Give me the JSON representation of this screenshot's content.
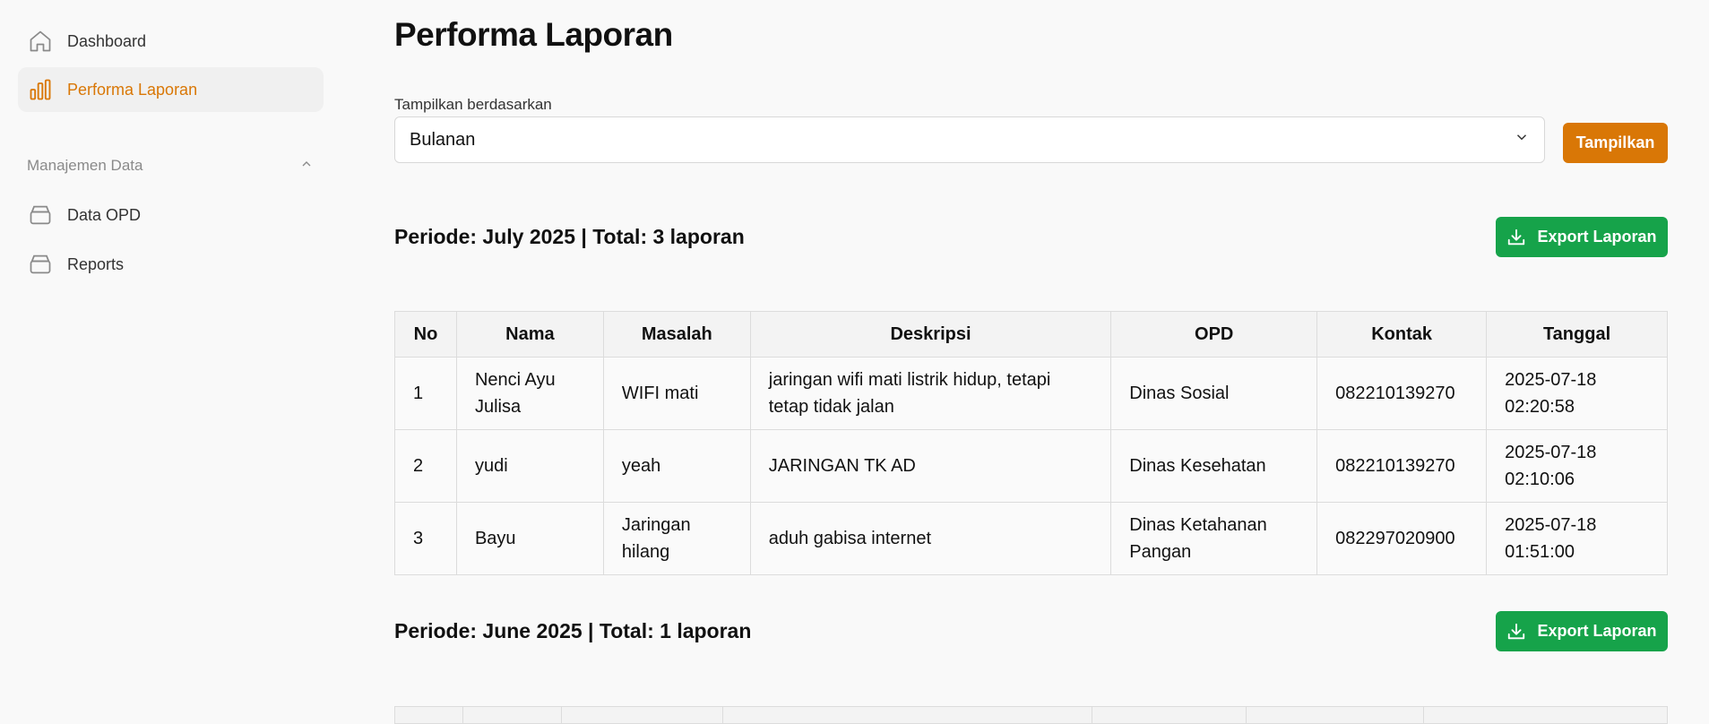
{
  "sidebar": {
    "items": [
      {
        "label": "Dashboard",
        "icon": "home-icon"
      },
      {
        "label": "Performa Laporan",
        "icon": "bar-chart-icon"
      }
    ],
    "section": {
      "label": "Manajemen Data",
      "icon": "chevron-up-icon"
    },
    "section_items": [
      {
        "label": "Data OPD",
        "icon": "database-icon"
      },
      {
        "label": "Reports",
        "icon": "database-icon"
      }
    ]
  },
  "page": {
    "title": "Performa Laporan",
    "filter_label": "Tampilkan berdasarkan",
    "filter_value": "Bulanan",
    "show_button": "Tampilkan"
  },
  "colors": {
    "accent": "#d97706",
    "export": "#16a34a"
  },
  "table_headers": [
    "No",
    "Nama",
    "Masalah",
    "Deskripsi",
    "OPD",
    "Kontak",
    "Tanggal"
  ],
  "periods": [
    {
      "title": "Periode: July 2025 | Total: 3 laporan",
      "export_label": "Export Laporan",
      "rows": [
        {
          "no": "1",
          "nama": "Nenci Ayu Julisa",
          "masalah": "WIFI mati",
          "deskripsi": "jaringan wifi mati listrik hidup, tetapi tetap tidak jalan",
          "opd": "Dinas Sosial",
          "kontak": "082210139270",
          "tanggal": "2025-07-18 02:20:58"
        },
        {
          "no": "2",
          "nama": "yudi",
          "masalah": "yeah",
          "deskripsi": "JARINGAN TK AD",
          "opd": "Dinas Kesehatan",
          "kontak": "082210139270",
          "tanggal": "2025-07-18 02:10:06"
        },
        {
          "no": "3",
          "nama": "Bayu",
          "masalah": "Jaringan hilang",
          "deskripsi": "aduh gabisa internet",
          "opd": "Dinas Ketahanan Pangan",
          "kontak": "082297020900",
          "tanggal": "2025-07-18 01:51:00"
        }
      ]
    },
    {
      "title": "Periode: June 2025 | Total: 1 laporan",
      "export_label": "Export Laporan"
    }
  ]
}
